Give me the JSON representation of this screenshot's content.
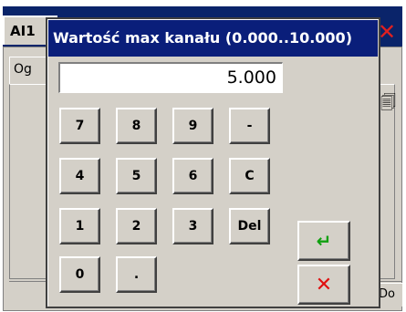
{
  "background": {
    "window_tab_label": "AI1",
    "inner_tab_label": "Og",
    "bottom_right_label": "Do",
    "close_glyph": "✕",
    "icon_glyph": "🗐"
  },
  "dialog": {
    "title": "Wartość max kanału (0.000..10.000)",
    "display_value": "5.000"
  },
  "keypad": {
    "row1": [
      "7",
      "8",
      "9",
      "-"
    ],
    "row2": [
      "4",
      "5",
      "6",
      "C"
    ],
    "row3": [
      "1",
      "2",
      "3",
      "Del"
    ],
    "row4": [
      "0",
      "."
    ]
  },
  "actions": {
    "enter_glyph": "↵",
    "cancel_glyph": "✕"
  },
  "colors": {
    "title_bar": "#0a1e7a",
    "face": "#d4d0c8",
    "enter_accent": "#10a010",
    "cancel_accent": "#e01010"
  }
}
